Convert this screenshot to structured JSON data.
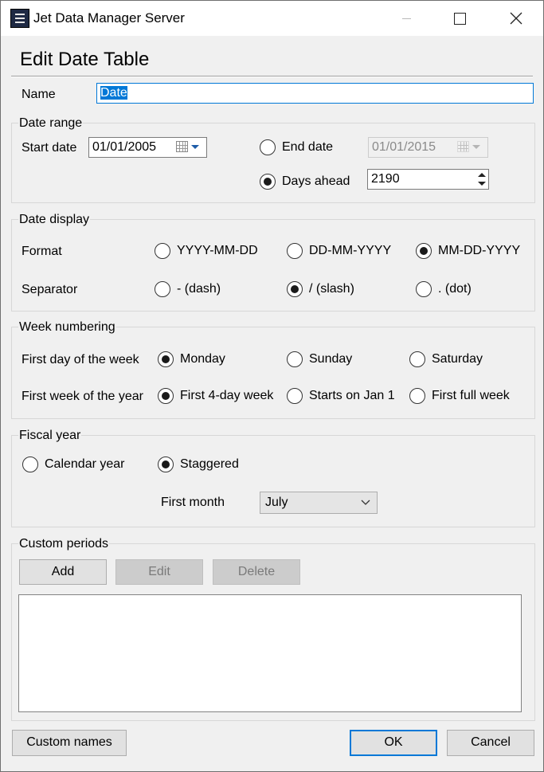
{
  "window": {
    "title": "Jet Data Manager Server"
  },
  "dialog": {
    "heading": "Edit Date Table"
  },
  "name_field": {
    "label": "Name",
    "value": "Date"
  },
  "date_range": {
    "group_label": "Date range",
    "start_label": "Start date",
    "start_value": "01/01/2005",
    "end_label": "End date",
    "end_value": "01/01/2015",
    "end_selected": false,
    "days_label": "Days ahead",
    "days_value": "2190",
    "days_selected": true
  },
  "date_display": {
    "group_label": "Date display",
    "format_label": "Format",
    "formats": [
      "YYYY-MM-DD",
      "DD-MM-YYYY",
      "MM-DD-YYYY"
    ],
    "format_selected": "MM-DD-YYYY",
    "separator_label": "Separator",
    "separators": [
      "- (dash)",
      "/ (slash)",
      ". (dot)"
    ],
    "separator_selected": "/ (slash)"
  },
  "week_numbering": {
    "group_label": "Week numbering",
    "first_day_label": "First day of the week",
    "first_day_options": [
      "Monday",
      "Sunday",
      "Saturday"
    ],
    "first_day_selected": "Monday",
    "first_week_label": "First week of the year",
    "first_week_options": [
      "First 4-day week",
      "Starts on Jan 1",
      "First full week"
    ],
    "first_week_selected": "First 4-day week"
  },
  "fiscal_year": {
    "group_label": "Fiscal year",
    "options": [
      "Calendar year",
      "Staggered"
    ],
    "selected": "Staggered",
    "first_month_label": "First month",
    "first_month_value": "July"
  },
  "custom_periods": {
    "group_label": "Custom periods",
    "add_label": "Add",
    "edit_label": "Edit",
    "delete_label": "Delete",
    "items": []
  },
  "footer": {
    "custom_names_label": "Custom names",
    "ok_label": "OK",
    "cancel_label": "Cancel"
  },
  "colors": {
    "accent": "#0078d7",
    "dialog_bg": "#f0f0f0",
    "disabled_text": "#8a8a8a"
  },
  "icons": [
    "app-icon",
    "minimize-icon",
    "maximize-icon",
    "close-icon",
    "calendar-icon",
    "chevron-down-icon",
    "spin-up-icon",
    "spin-down-icon"
  ]
}
